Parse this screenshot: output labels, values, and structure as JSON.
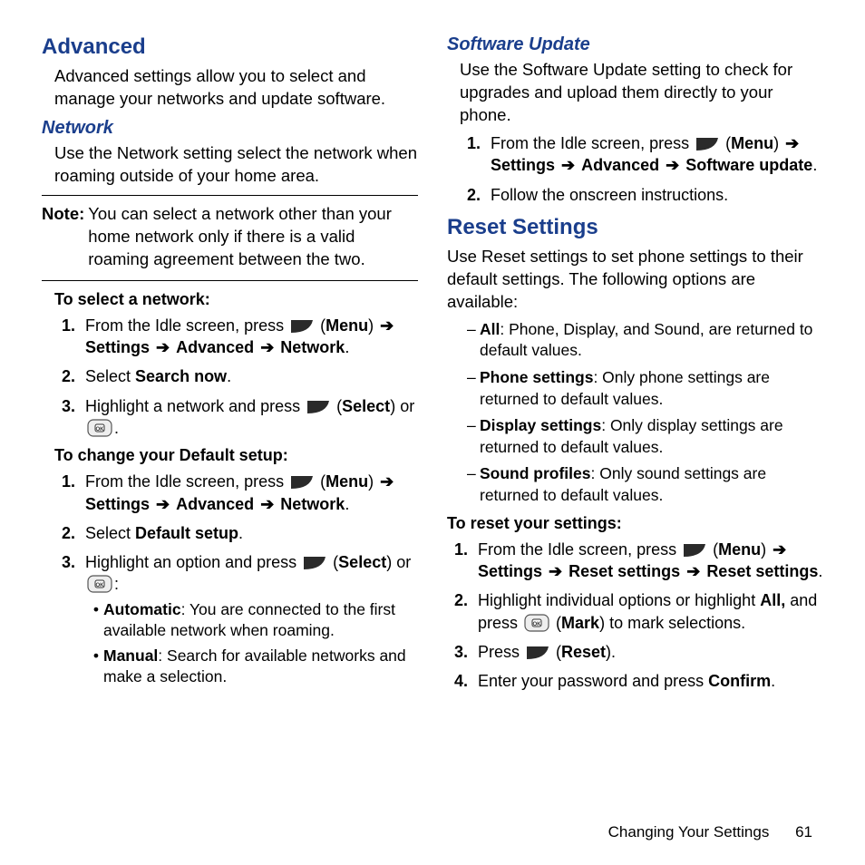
{
  "left": {
    "heading_advanced": "Advanced",
    "advanced_intro": "Advanced settings allow you to select and manage your networks and update software.",
    "heading_network": "Network",
    "network_intro": "Use the Network setting select the network when roaming outside of your home area.",
    "note_label": "Note:",
    "note_text": "You can select a network other than your home network only if there is a valid roaming agreement between the two.",
    "subhead_select": "To select a network:",
    "sel_steps": {
      "s1_a": "From the Idle screen, press ",
      "s1_menu": "Menu",
      "s1_b": "Settings",
      "s1_c": "Advanced",
      "s1_d": "Network",
      "s2_a": "Select ",
      "s2_b": "Search now",
      "s3_a": "Highlight a network and press ",
      "s3_select": "Select",
      "s3_b": " or "
    },
    "subhead_default": "To change your Default setup:",
    "def_steps": {
      "s1_a": "From the Idle screen, press ",
      "s1_menu": "Menu",
      "s1_b": "Settings",
      "s1_c": "Advanced",
      "s1_d": "Network",
      "s2_a": "Select ",
      "s2_b": "Default setup",
      "s3_a": "Highlight an option and press ",
      "s3_select": "Select",
      "s3_b": " or ",
      "bullets": {
        "auto_l": "Automatic",
        "auto_t": ": You are connected to the first available network when roaming.",
        "man_l": "Manual",
        "man_t": ": Search for available networks and make a selection."
      }
    }
  },
  "right": {
    "heading_su": "Software Update",
    "su_intro": "Use the Software Update setting to check for upgrades and upload them directly to your phone.",
    "su_steps": {
      "s1_a": "From the Idle screen, press ",
      "s1_menu": "Menu",
      "s1_b": "Settings",
      "s1_c": "Advanced ",
      "s1_d": "Software update",
      "s2": "Follow the onscreen instructions."
    },
    "heading_reset": "Reset Settings",
    "reset_intro": "Use Reset settings to set phone settings to their default settings. The following options are available:",
    "options": {
      "all_l": "All",
      "all_t": ": Phone, Display, and Sound, are returned to default values.",
      "ph_l": "Phone settings",
      "ph_t": ": Only phone settings are returned to default values.",
      "dp_l": "Display settings",
      "dp_t": ": Only display settings are returned to default values.",
      "sp_l": "Sound profiles",
      "sp_t": ": Only sound settings are returned to default values."
    },
    "subhead_reset": "To reset your settings:",
    "reset_steps": {
      "s1_a": "From the Idle screen, press ",
      "s1_menu": "Menu",
      "s1_b": "Settings",
      "s1_c": "Reset settings",
      "s1_d": "Reset settings",
      "s2_a": "Highlight individual options or highlight ",
      "s2_all": "All,",
      "s2_b": " and press ",
      "s2_mark": "Mark",
      "s2_c": " to mark selections.",
      "s3_a": "Press ",
      "s3_reset": "Reset",
      "s4_a": "Enter your password and press ",
      "s4_confirm": "Confirm"
    }
  },
  "nums": {
    "n1": "1.",
    "n2": "2.",
    "n3": "3.",
    "n4": "4."
  },
  "sym": {
    "arrow": "➔",
    "bullet": "•",
    "dash": "–"
  },
  "footer": {
    "title": "Changing Your Settings",
    "page": "61"
  }
}
